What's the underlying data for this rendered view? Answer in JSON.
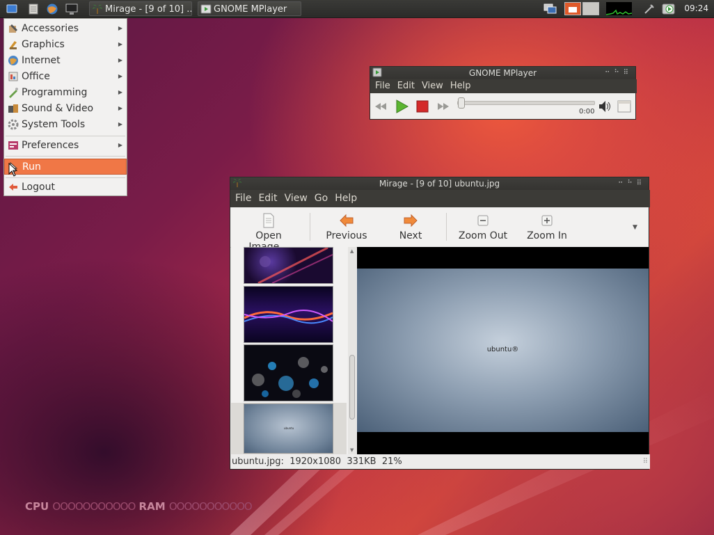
{
  "panel": {
    "launchers": [
      "show-desktop-icon",
      "file-manager-icon",
      "web-browser-icon",
      "terminal-icon"
    ],
    "tasks": [
      {
        "label": "Mirage - [9 of 10] ...",
        "icon": "palm-tree-icon"
      },
      {
        "label": "GNOME MPlayer",
        "icon": "mplayer-icon"
      }
    ],
    "tray": [
      "workspaces-icon",
      "window-switch-icon",
      "cpu-graph-icon",
      "network-icon",
      "mplayer-tray-icon"
    ],
    "clock": "09:24"
  },
  "app_menu": {
    "items": [
      {
        "label": "Accessories",
        "icon": "accessories-icon",
        "submenu": true
      },
      {
        "label": "Graphics",
        "icon": "graphics-icon",
        "submenu": true
      },
      {
        "label": "Internet",
        "icon": "internet-icon",
        "submenu": true
      },
      {
        "label": "Office",
        "icon": "office-icon",
        "submenu": true
      },
      {
        "label": "Programming",
        "icon": "programming-icon",
        "submenu": true
      },
      {
        "label": "Sound & Video",
        "icon": "sound-video-icon",
        "submenu": true
      },
      {
        "label": "System Tools",
        "icon": "system-tools-icon",
        "submenu": true
      }
    ],
    "preferences": {
      "label": "Preferences",
      "icon": "preferences-icon"
    },
    "run": {
      "label": "Run",
      "icon": "run-icon"
    },
    "logout": {
      "label": "Logout",
      "icon": "logout-icon"
    }
  },
  "mplayer": {
    "title": "GNOME MPlayer",
    "menu": [
      "File",
      "Edit",
      "View",
      "Help"
    ],
    "time": "0:00",
    "progress": 0
  },
  "mirage": {
    "title": "Mirage - [9 of 10] ubuntu.jpg",
    "menu": [
      "File",
      "Edit",
      "View",
      "Go",
      "Help"
    ],
    "toolbar": {
      "open": "Open Image...",
      "previous": "Previous",
      "next": "Next",
      "zoom_out": "Zoom Out",
      "zoom_in": "Zoom In"
    },
    "image_text": "ubuntu®",
    "status": "ubuntu.jpg:  1920x1080  331KB  21%"
  },
  "conky": {
    "cpu_label": "CPU",
    "cpu_dots": "OOOOOOOOOOO",
    "ram_label": "RAM",
    "ram_dots": "OOOOOOOOOOO"
  },
  "colors": {
    "accent": "#f07746",
    "panel": "#3a3a37",
    "menubar": "#3c3b37"
  }
}
